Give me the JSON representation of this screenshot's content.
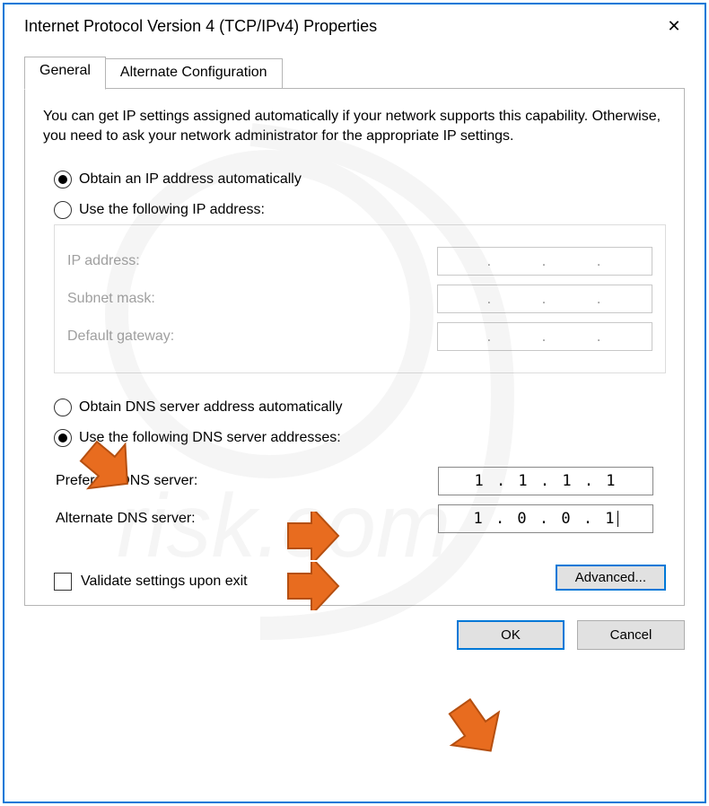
{
  "window": {
    "title": "Internet Protocol Version 4 (TCP/IPv4) Properties"
  },
  "tabs": {
    "general": "General",
    "alternate": "Alternate Configuration"
  },
  "intro": "You can get IP settings assigned automatically if your network supports this capability. Otherwise, you need to ask your network administrator for the appropriate IP settings.",
  "ip_section": {
    "radio_auto": "Obtain an IP address automatically",
    "radio_manual": "Use the following IP address:",
    "selected": "auto",
    "fields": {
      "ip_label": "IP address:",
      "subnet_label": "Subnet mask:",
      "gateway_label": "Default gateway:",
      "ip_value": "",
      "subnet_value": "",
      "gateway_value": ""
    }
  },
  "dns_section": {
    "radio_auto": "Obtain DNS server address automatically",
    "radio_manual": "Use the following DNS server addresses:",
    "selected": "manual",
    "fields": {
      "preferred_label": "Preferred DNS server:",
      "alternate_label": "Alternate DNS server:",
      "preferred_value": "1 . 1 . 1 . 1",
      "alternate_value": "1 . 0 . 0 . 1"
    }
  },
  "validate_checkbox": {
    "label": "Validate settings upon exit",
    "checked": false
  },
  "buttons": {
    "advanced": "Advanced...",
    "ok": "OK",
    "cancel": "Cancel"
  }
}
